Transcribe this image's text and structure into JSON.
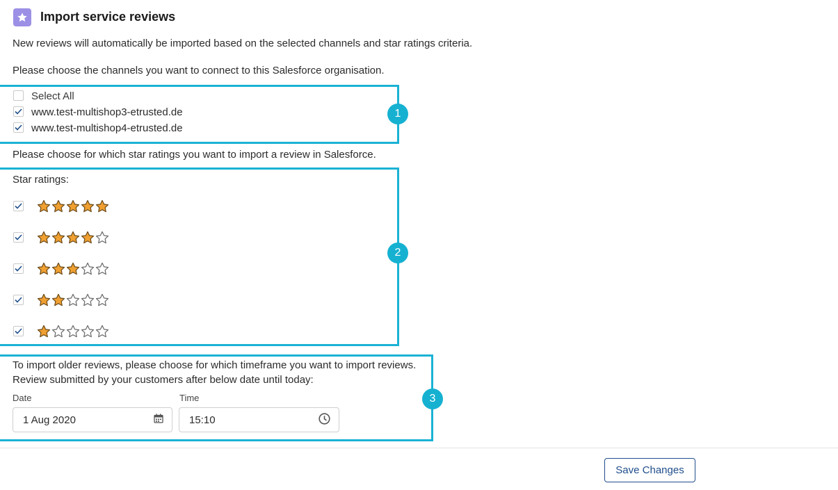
{
  "header": {
    "title": "Import service reviews",
    "icon": "star-icon",
    "icon_color": "#9c8fe6"
  },
  "intro": {
    "description": "New reviews will automatically be imported based on the selected channels and star ratings criteria.",
    "channels_prompt": "Please choose the channels you want to connect to this Salesforce organisation."
  },
  "channels": {
    "select_all": {
      "label": "Select All",
      "checked": false
    },
    "items": [
      {
        "label": "www.test-multishop3-etrusted.de",
        "checked": true
      },
      {
        "label": "www.test-multishop4-etrusted.de",
        "checked": true
      }
    ]
  },
  "ratings": {
    "prompt": "Please choose for which star ratings you want to import a review in Salesforce.",
    "label": "Star ratings:",
    "items": [
      {
        "stars": 5,
        "checked": true
      },
      {
        "stars": 4,
        "checked": true
      },
      {
        "stars": 3,
        "checked": true
      },
      {
        "stars": 2,
        "checked": true
      },
      {
        "stars": 1,
        "checked": true
      }
    ]
  },
  "timeframe": {
    "line1": "To import older reviews, please choose for which timeframe you want to import reviews.",
    "line2": "Review submitted by your customers after below date until today:",
    "date_label": "Date",
    "date_value": "1 Aug 2020",
    "time_label": "Time",
    "time_value": "15:10"
  },
  "annotations": {
    "badge1": "1",
    "badge2": "2",
    "badge3": "3",
    "color": "#1ab2d4"
  },
  "footer": {
    "save_label": "Save Changes"
  },
  "colors": {
    "accent": "#1f4e8c",
    "star_fill": "#f0a030",
    "check": "#1f4e8c"
  }
}
